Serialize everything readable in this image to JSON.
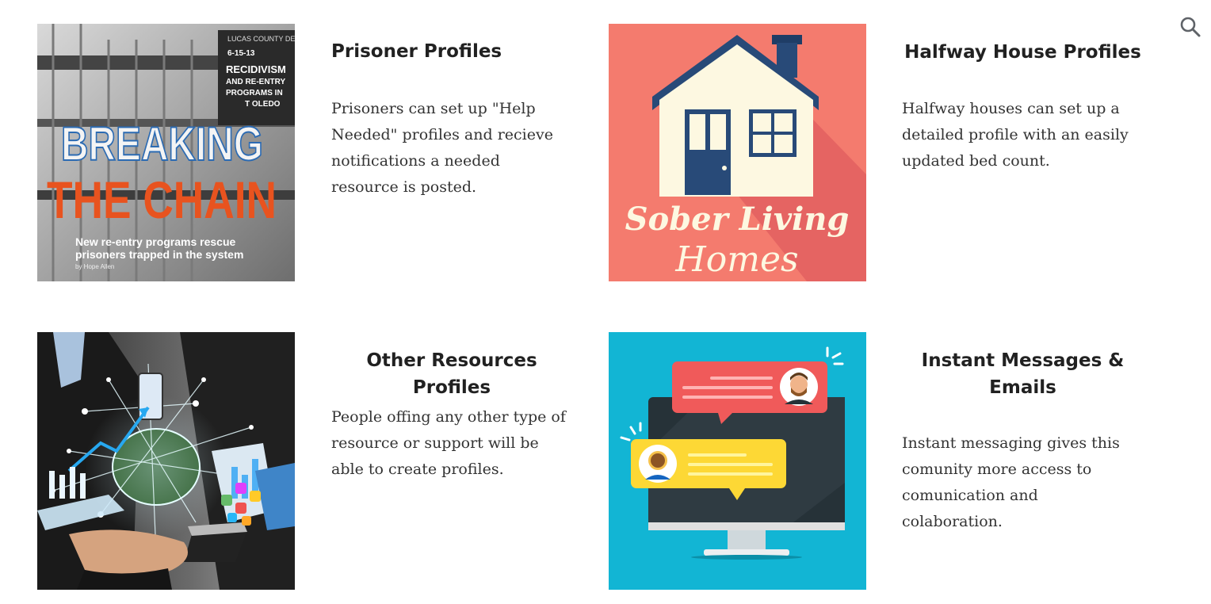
{
  "header": {
    "search_icon": "search-icon"
  },
  "cards": [
    {
      "title": "Prisoner Profiles",
      "description": "Prisoners can set up  \"Help Needed\" profiles and recieve notifications a needed resource is posted.",
      "image": {
        "sign_lines": [
          "LUCAS COUNTY DEP",
          "6-15-13",
          "RECIDIVISM",
          "AND RE-ENTRY",
          "PROGRAMS IN",
          "T OLEDO"
        ],
        "headline_1": "BREAKING",
        "headline_2": "THE CHAIN",
        "subhead_1": "New re-entry programs rescue",
        "subhead_2": "prisoners trapped in the system",
        "byline": "by Hope Allen",
        "headline_color": "#e8531f"
      }
    },
    {
      "title": "Halfway House Profiles",
      "description": "Halfway houses can set up a detailed profile with an easily updated bed count.",
      "image": {
        "line_1": "Sober Living",
        "line_2": "Homes",
        "bg_color": "#f47b6e",
        "roof_color": "#284a78",
        "house_color": "#fdf8e1"
      }
    },
    {
      "title": "Other Resources Profiles",
      "description": "People offing any other type of resource or support will be able to create profiles."
    },
    {
      "title": "Instant Messages & Emails",
      "description": "Instant messaging gives this comunity more access to comunication and colaboration.",
      "image": {
        "bg_color": "#12b5d4",
        "bubble_red": "#f05a5a",
        "bubble_yellow": "#fdd835"
      }
    }
  ]
}
